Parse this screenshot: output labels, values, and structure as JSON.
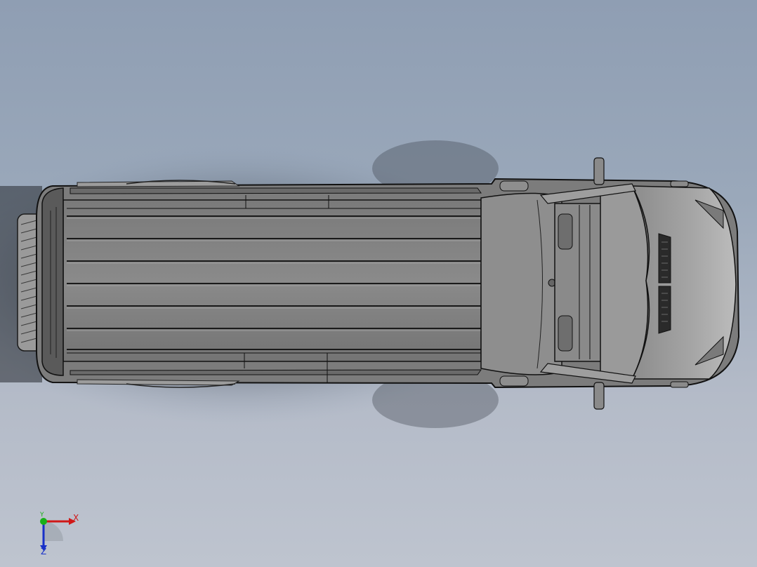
{
  "viewport": {
    "background_top": "#8f9eb3",
    "background_bottom": "#bec4cf",
    "model": "van-top-view"
  },
  "triad": {
    "x_label": "X",
    "y_label": "Y",
    "z_label": "Z",
    "x_color": "#d01818",
    "y_color": "#18b018",
    "z_color": "#1830c8"
  }
}
